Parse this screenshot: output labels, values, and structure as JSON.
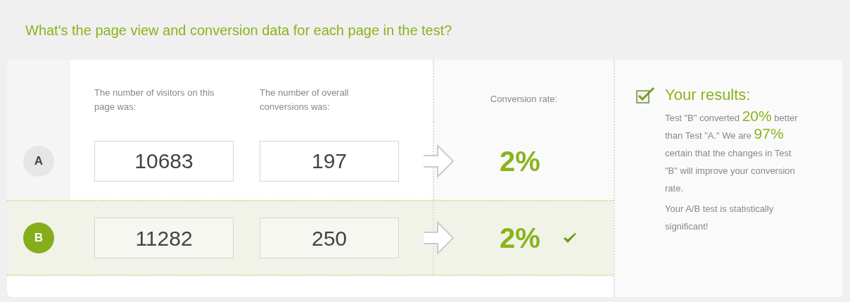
{
  "title": "What's the page view and conversion data for each page in the test?",
  "columns": {
    "visitors": "The number of visitors on this page was:",
    "conversions": "The number of overall conversions was:",
    "rate": "Conversion rate:"
  },
  "rows": [
    {
      "label": "A",
      "visitors": "10683",
      "conversions": "197",
      "rate": "2%",
      "selected": false,
      "winner": false
    },
    {
      "label": "B",
      "visitors": "11282",
      "conversions": "250",
      "rate": "2%",
      "selected": true,
      "winner": true
    }
  ],
  "results": {
    "heading": "Your results:",
    "checked": true,
    "summary": [
      {
        "text": "Test \"B\" converted ",
        "emphasis": false
      },
      {
        "text": "20%",
        "emphasis": true
      },
      {
        "text": " better than Test \"A.\" We are ",
        "emphasis": false
      },
      {
        "text": "97%",
        "emphasis": true
      },
      {
        "text": " certain that the changes in Test \"B\" will improve your conversion rate.",
        "emphasis": false
      }
    ],
    "verdict": "Your A/B test is statistically significant!"
  }
}
